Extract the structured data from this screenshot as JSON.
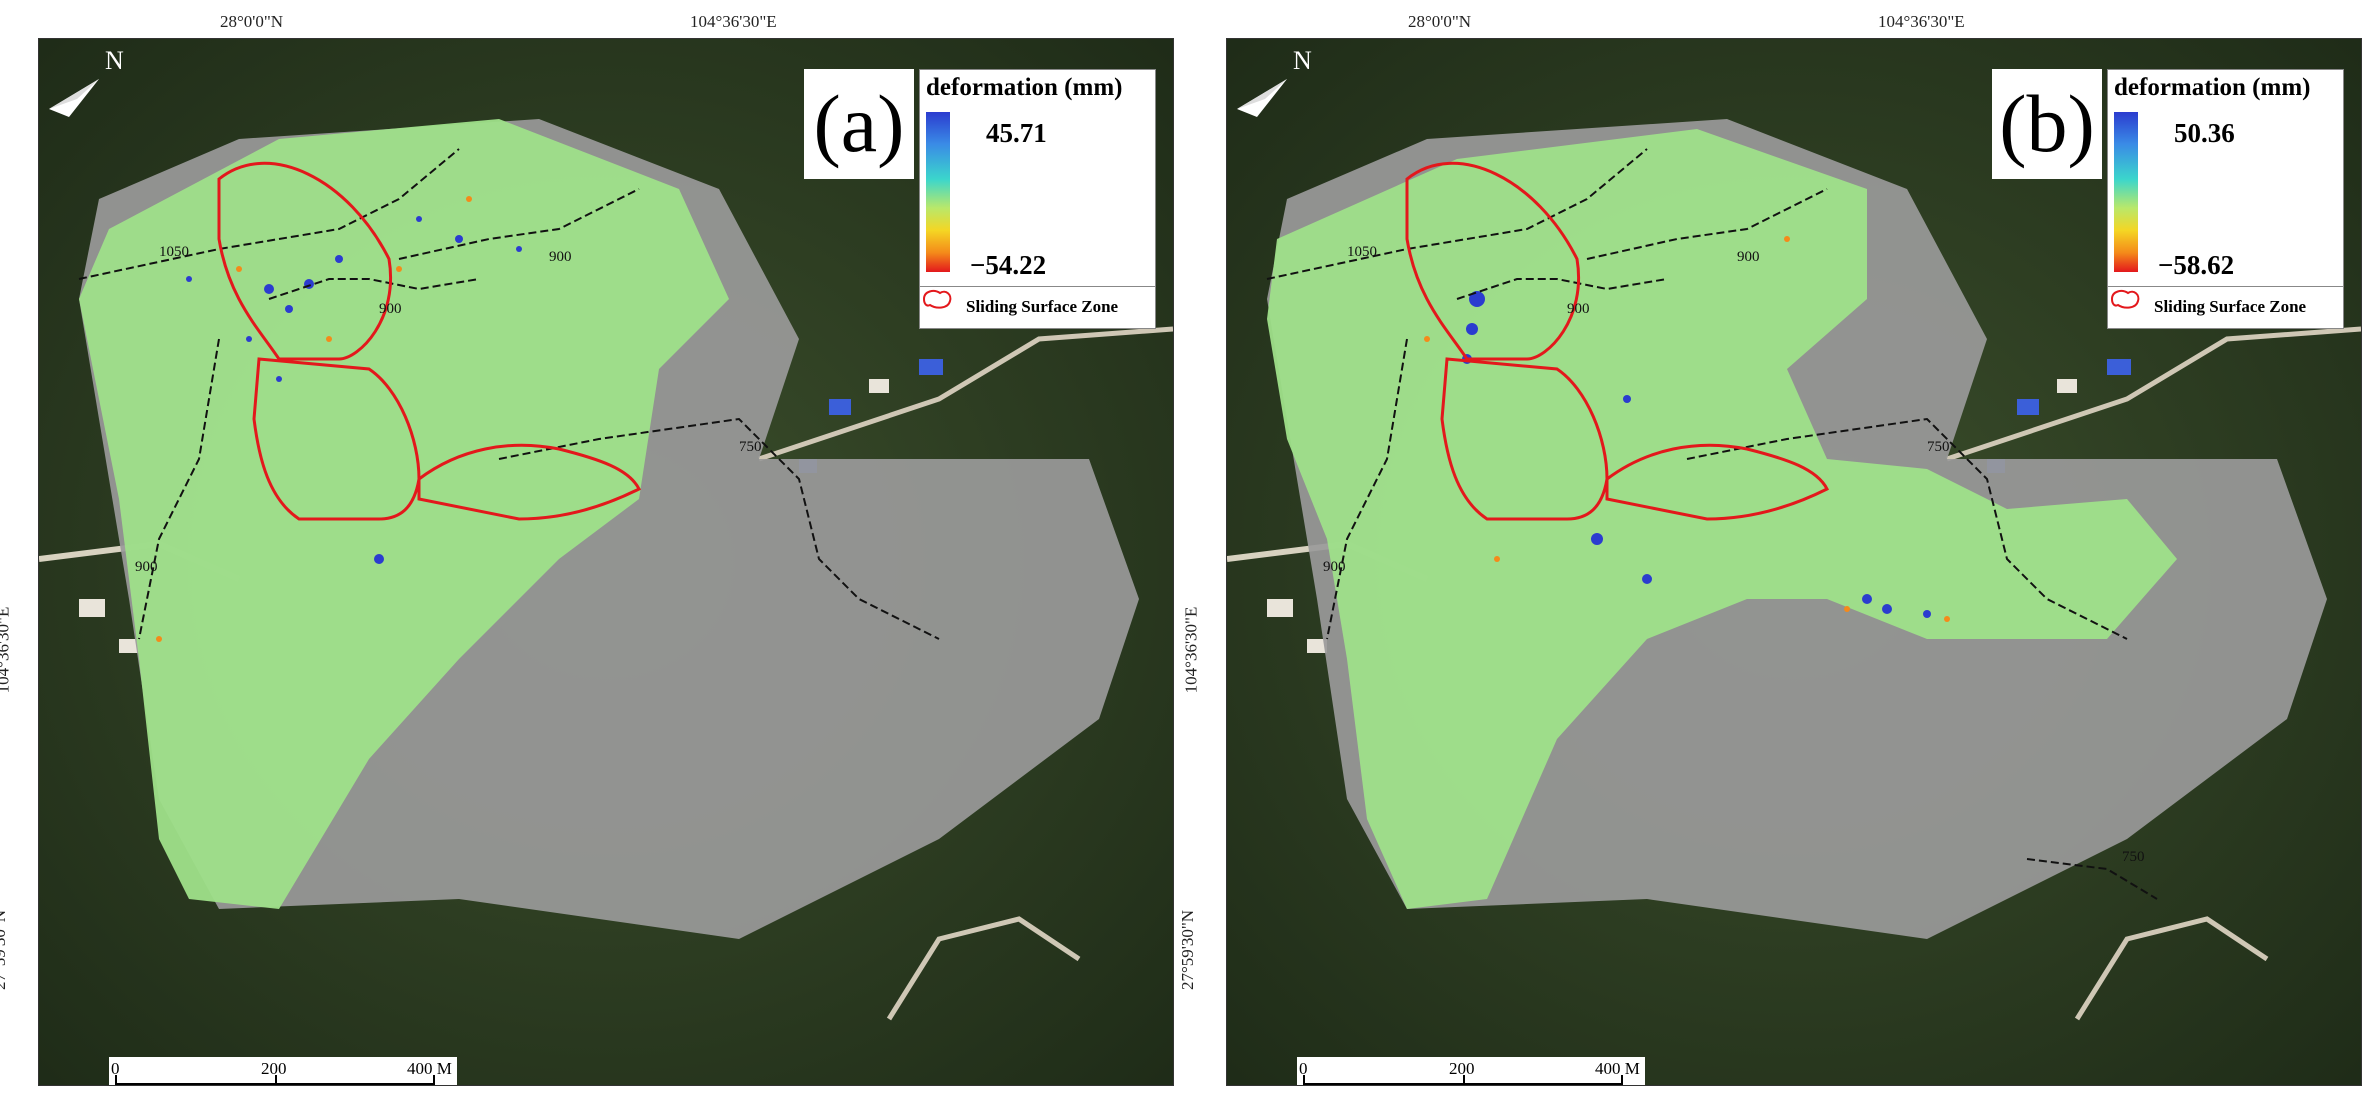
{
  "panels": [
    {
      "id": "a",
      "label": "(a)",
      "coords": {
        "top_left": "28°0'0\"N",
        "top_right": "104°36'30\"E",
        "left_upper": "104°36'30\"E",
        "left_lower": "27°59'30\"N"
      },
      "legend": {
        "title": "deformation (mm)",
        "max": "45.71",
        "min": "−54.22",
        "zone_label": "Sliding Surface Zone"
      },
      "contours": [
        "1050",
        "900",
        "900",
        "750",
        "900"
      ],
      "scale": {
        "t0": "0",
        "t1": "200",
        "t2": "400 M"
      }
    },
    {
      "id": "b",
      "label": "(b)",
      "coords": {
        "top_left": "28°0'0\"N",
        "top_right": "104°36'30\"E",
        "left_upper": "104°36'30\"E",
        "left_lower": "27°59'30\"N"
      },
      "legend": {
        "title": "deformation (mm)",
        "max": "50.36",
        "min": "−58.62",
        "zone_label": "Sliding Surface Zone"
      },
      "contours": [
        "1050",
        "900",
        "900",
        "750",
        "900",
        "750"
      ],
      "scale": {
        "t0": "0",
        "t1": "200",
        "t2": "400 M"
      }
    }
  ],
  "colors": {
    "deformation_high": "#2b3ccf",
    "deformation_low": "#e3181c",
    "stable": "#9fe08a",
    "zone_outline": "#e3181c",
    "hillshade": "#9a9a9a"
  }
}
